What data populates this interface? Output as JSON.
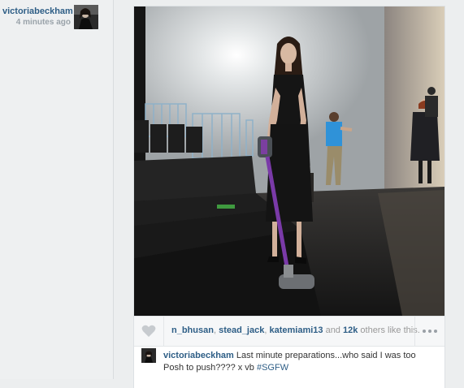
{
  "author": {
    "username": "victoriabeckham",
    "time_ago": "4 minutes ago",
    "avatar": "profile-photo"
  },
  "post": {
    "photo": "backstage runway photo",
    "likes": {
      "users": [
        "n_bhusan",
        "stead_jack",
        "katemiami13"
      ],
      "separator_1": ", ",
      "separator_2": ", ",
      "and_text": " and ",
      "count": "12k",
      "suffix": " others like this."
    },
    "caption": {
      "username": "victoriabeckham",
      "text": " Last minute preparations...who said I was too Posh to push???? x vb ",
      "hashtag": "#SGFW"
    },
    "icons": {
      "like": "heart-icon",
      "more": "more-options-icon"
    }
  },
  "colors": {
    "link": "#2e5e86",
    "background": "#eceeef",
    "muted": "#999999"
  }
}
